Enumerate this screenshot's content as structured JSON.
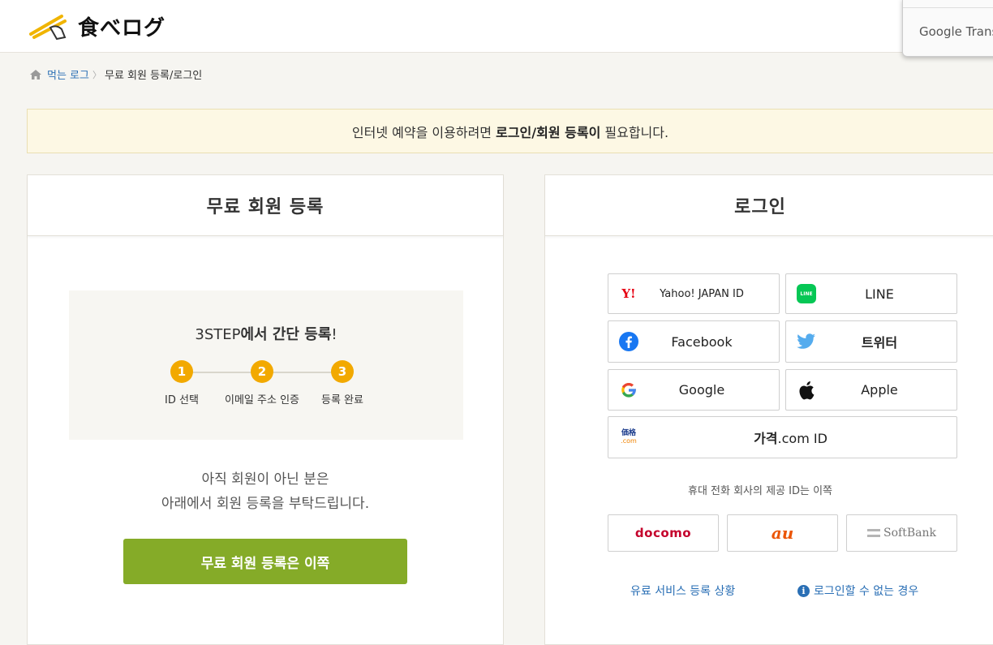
{
  "header": {
    "logo_text": "食べログ",
    "translate_popup": "Google Transl"
  },
  "breadcrumb": {
    "home": "먹는 로그",
    "separator": "〉",
    "current": "무료 회원 등록/로그인"
  },
  "notice": {
    "prefix": "인터넷 예약을 이용하려면 ",
    "emphasis": "로그인/회원 등록이",
    "suffix": " 필요합니다."
  },
  "register": {
    "title": "무료 회원 등록",
    "steps_title_prefix": "3STEP",
    "steps_title_bold": "에서 간단 등록",
    "steps_title_suffix": "!",
    "steps": [
      {
        "num": "1",
        "label": "ID 선택"
      },
      {
        "num": "2",
        "label": "이메일 주소 인증"
      },
      {
        "num": "3",
        "label": "등록 완료"
      }
    ],
    "text_line1": "아직 회원이 아닌 분은",
    "text_line2": "아래에서 회원 등록을 부탁드립니다.",
    "button": "무료 회원 등록은 이쪽"
  },
  "login": {
    "title": "로그인",
    "buttons": {
      "yahoo": "Yahoo! JAPAN ID",
      "line": "LINE",
      "facebook": "Facebook",
      "twitter": "트위터",
      "google": "Google",
      "apple": "Apple",
      "kakaku_bold": "가격",
      "kakaku_rest": ".com ID"
    },
    "icons": {
      "yahoo_mark": "Y!",
      "line_mark": "LINE",
      "kakaku_mark_top": "価格",
      "kakaku_mark_bottom": ".com"
    },
    "carrier_note": "휴대 전화 회사의 제공 ID는 이쪽",
    "carriers": {
      "docomo": "docomo",
      "au": "au",
      "softbank": "SoftBank"
    },
    "links": {
      "paid": "유료 서비스 등록 상황",
      "cannot_login": "로그인할 수 없는 경우",
      "info_mark": "i"
    }
  },
  "colors": {
    "accent_green": "#85ab28",
    "step_orange": "#f2a900",
    "link_blue": "#2a6fb5",
    "notice_bg": "#fdf8e4"
  }
}
